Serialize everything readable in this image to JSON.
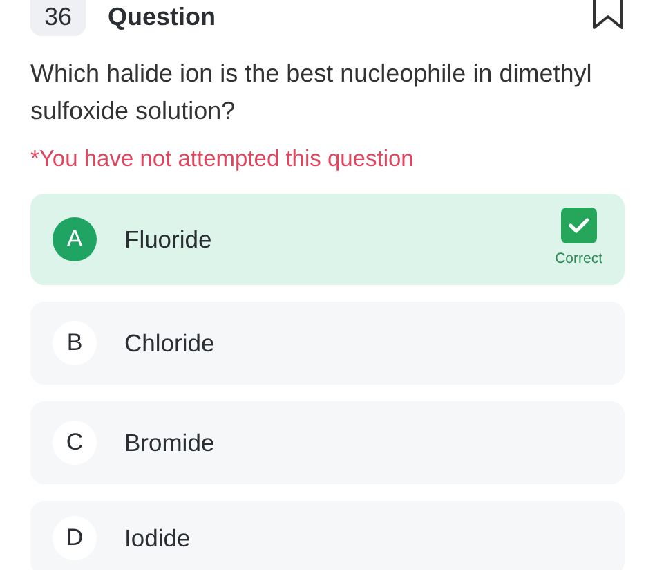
{
  "question": {
    "number": "36",
    "title": "Question",
    "bookmarked": false,
    "text": "Which halide ion is the best nucleophile in dimethyl sulfoxide solution?",
    "note": "*You have not attempted this question"
  },
  "options": [
    {
      "letter": "A",
      "label": "Fluoride",
      "correct": true,
      "badge": "Correct"
    },
    {
      "letter": "B",
      "label": "Chloride",
      "correct": false
    },
    {
      "letter": "C",
      "label": "Bromide",
      "correct": false
    },
    {
      "letter": "D",
      "label": "Iodide",
      "correct": false
    }
  ]
}
